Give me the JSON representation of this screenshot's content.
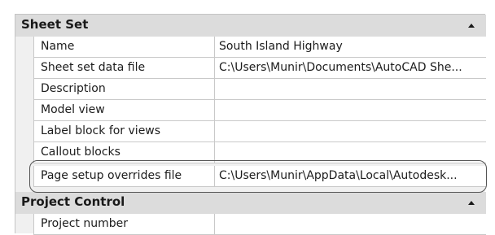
{
  "sheet_set": {
    "title": "Sheet Set",
    "collapse_icon": "triangle-up-icon",
    "rows": [
      {
        "name": "Name",
        "value": "South Island Highway"
      },
      {
        "name": "Sheet set data file",
        "value": "C:\\Users\\Munir\\Documents\\AutoCAD She..."
      },
      {
        "name": "Description",
        "value": ""
      },
      {
        "name": "Model view",
        "value": ""
      },
      {
        "name": "Label block for views",
        "value": ""
      },
      {
        "name": "Callout blocks",
        "value": ""
      },
      {
        "name": "Page setup overrides file",
        "value": "C:\\Users\\Munir\\AppData\\Local\\Autodesk..."
      }
    ]
  },
  "project_control": {
    "title": "Project Control",
    "collapse_icon": "triangle-up-icon",
    "rows": [
      {
        "name": "Project number",
        "value": ""
      }
    ]
  },
  "colors": {
    "category_bg": "#dcdcdc",
    "grid_line": "#c9c9c9",
    "highlight_outline": "#555555"
  }
}
